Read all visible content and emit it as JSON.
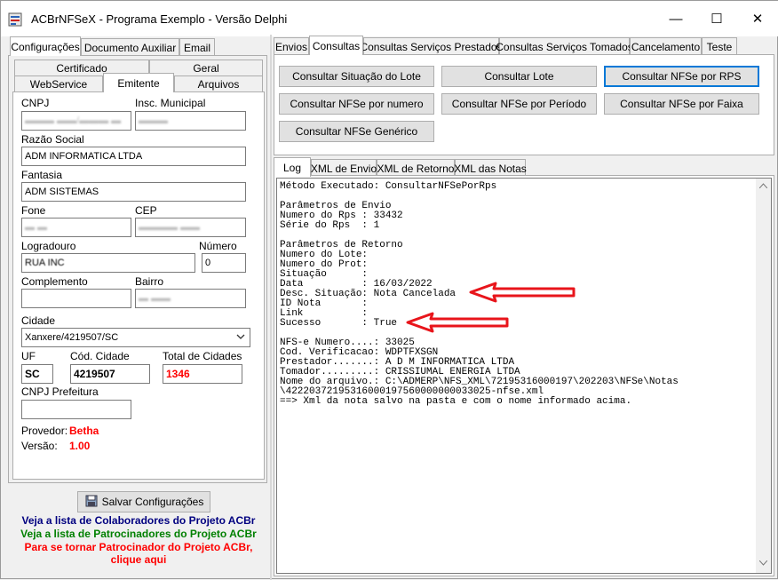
{
  "window": {
    "title": "ACBrNFSeX - Programa Exemplo - Versão Delphi",
    "minimize": "—",
    "maximize": "☐",
    "close": "✕"
  },
  "left": {
    "tabs": [
      "Configurações",
      "Documento Auxiliar",
      "Email"
    ],
    "subtabs_row1": [
      "Certificado",
      "Geral"
    ],
    "subtabs_row2": [
      "WebService",
      "Emitente",
      "Arquivos"
    ],
    "fields": {
      "cnpj_label": "CNPJ",
      "cnpj_value": "",
      "im_label": "Insc. Municipal",
      "im_value": "",
      "razao_label": "Razão Social",
      "razao_value": "ADM INFORMATICA LTDA",
      "fantasia_label": "Fantasia",
      "fantasia_value": "ADM SISTEMAS",
      "fone_label": "Fone",
      "fone_value": "",
      "cep_label": "CEP",
      "cep_value": "",
      "logradouro_label": "Logradouro",
      "logradouro_value": "RUA INC",
      "numero_label": "Número",
      "numero_value": "0",
      "complemento_label": "Complemento",
      "complemento_value": "",
      "bairro_label": "Bairro",
      "bairro_value": "",
      "cidade_label": "Cidade",
      "cidade_value": "Xanxere/4219507/SC",
      "uf_label": "UF",
      "uf_value": "SC",
      "cod_cidade_label": "Cód. Cidade",
      "cod_cidade_value": "4219507",
      "total_label": "Total de Cidades",
      "total_value": "1346",
      "cnpj_pref_label": "CNPJ Prefeitura",
      "cnpj_pref_value": "",
      "provedor_label": "Provedor:",
      "provedor_value": "Betha",
      "versao_label": "Versão:",
      "versao_value": "1.00"
    },
    "save_button": "Salvar Configurações",
    "links": {
      "colaboradores": "Veja a lista de Colaboradores do Projeto ACBr",
      "patrocinadores": "Veja a lista de Patrocinadores do Projeto ACBr",
      "tornar1": "Para se tornar Patrocinador do Projeto ACBr,",
      "tornar2": "clique aqui"
    }
  },
  "right": {
    "tabs": [
      "Envios",
      "Consultas",
      "Consultas Serviços Prestados",
      "Consultas Serviços Tomados",
      "Cancelamento",
      "Teste"
    ],
    "buttons": [
      "Consultar Situação do Lote",
      "Consultar Lote",
      "Consultar NFSe por RPS",
      "Consultar NFSe por numero",
      "Consultar NFSe por Período",
      "Consultar NFSe por Faixa",
      "Consultar NFSe Genérico"
    ],
    "log_tabs": [
      "Log",
      "XML de Envio",
      "XML de Retorno",
      "XML das Notas"
    ],
    "log_lines": [
      "Método Executado: ConsultarNFSePorRps",
      "",
      "Parâmetros de Envio",
      "Numero do Rps : 33432",
      "Série do Rps  : 1",
      "",
      "Parâmetros de Retorno",
      "Numero do Lote:",
      "Numero do Prot:",
      "Situação      :",
      "Data          : 16/03/2022",
      "Desc. Situação: Nota Cancelada",
      "ID Nota       :",
      "Link          :",
      "Sucesso       : True",
      "",
      "NFS-e Numero....: 33025",
      "Cod. Verificacao: WDPTFXSGN",
      "Prestador.......: A D M INFORMATICA LTDA",
      "Tomador.........: CRISSIUMAL ENERGIA LTDA",
      "Nome do arquivo.: C:\\ADMERP\\NFS_XML\\72195316000197\\202203\\NFSe\\Notas",
      "\\42220372195316000197560000000033025-nfse.xml",
      "==> Xml da nota salvo na pasta e com o nome informado acima."
    ]
  },
  "colors": {
    "arrow": "#e8151b",
    "link_blue": "#000080",
    "link_green": "#008000",
    "link_red": "#ff0000"
  }
}
